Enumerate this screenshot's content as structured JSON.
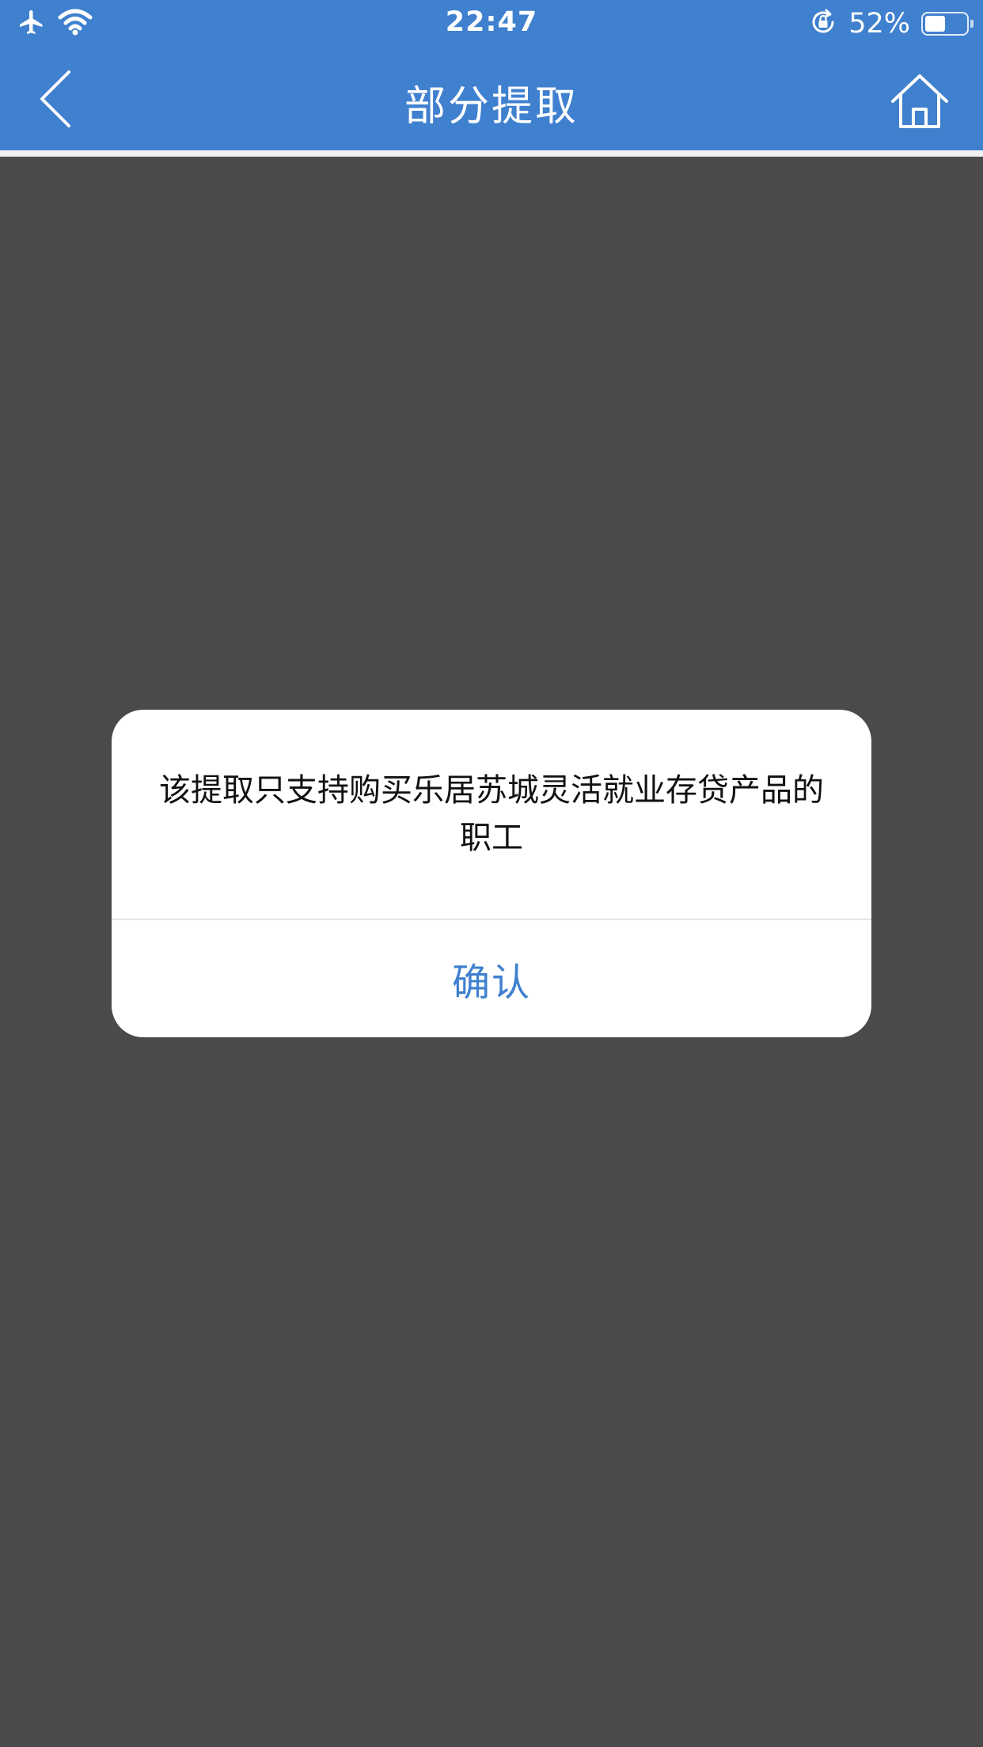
{
  "status_bar": {
    "time": "22:47",
    "battery_percent": "52%",
    "battery_level": 0.52,
    "icons": [
      "airplane-icon",
      "wifi-icon",
      "rotation-lock-icon",
      "battery-icon"
    ]
  },
  "nav": {
    "title": "部分提取",
    "back_icon": "chevron-left-icon",
    "home_icon": "home-icon"
  },
  "colors": {
    "accent": "#3f80cf",
    "overlay": "#4a4a4a",
    "alert_bg": "#ffffff"
  },
  "alert": {
    "message": "该提取只支持购买乐居苏城灵活就业存贷产品的职工",
    "confirm_label": "确认"
  }
}
